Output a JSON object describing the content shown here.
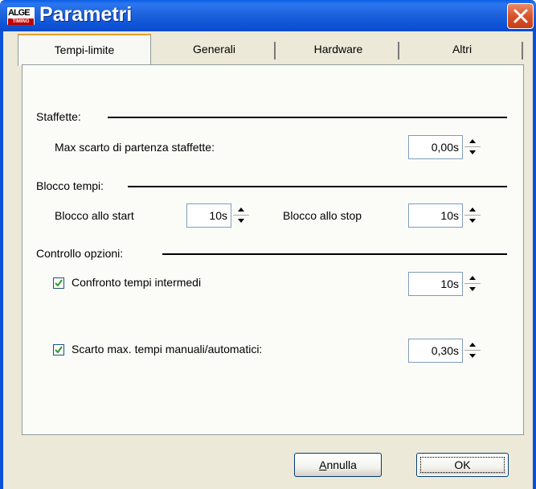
{
  "window": {
    "title": "Parametri",
    "logo_top": "ALGE",
    "logo_bottom": "TIMING"
  },
  "tabs": [
    {
      "label": "Tempi-limite",
      "active": true
    },
    {
      "label": "Generali",
      "active": false
    },
    {
      "label": "Hardware",
      "active": false
    },
    {
      "label": "Altri",
      "active": false
    }
  ],
  "sections": {
    "staffette": {
      "heading": "Staffette:",
      "max_label": "Max scarto di partenza staffette:",
      "max_value": "0,00s"
    },
    "blocco": {
      "heading": "Blocco tempi:",
      "start_label": "Blocco allo start",
      "start_value": "10s",
      "stop_label": "Blocco allo stop",
      "stop_value": "10s"
    },
    "controllo": {
      "heading": "Controllo opzioni:",
      "confronto_label": "Confronto tempi intermedi",
      "confronto_checked": true,
      "confronto_value": "10s",
      "scarto_label": "Scarto max. tempi manuali/automatici:",
      "scarto_checked": true,
      "scarto_value": "0,30s"
    }
  },
  "buttons": {
    "cancel_label_prefix": "A",
    "cancel_label_rest": "nnulla",
    "ok_label": "OK"
  },
  "colors": {
    "title_bar": "#1e63dc",
    "dialog_bg": "#ece9d8",
    "active_tab_accent": "#e0a030",
    "close_button": "#d8532a"
  }
}
